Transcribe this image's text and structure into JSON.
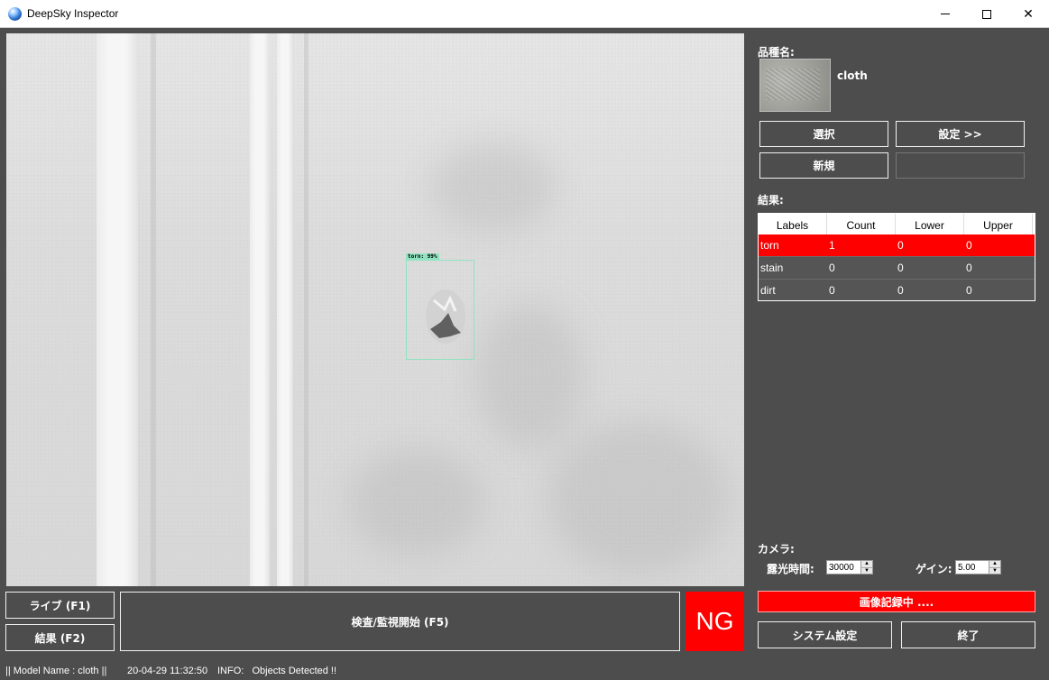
{
  "window": {
    "title": "DeepSky Inspector"
  },
  "camera_view": {
    "detection": {
      "label": "torn: 99%"
    }
  },
  "panel": {
    "model_heading": "品種名:",
    "model_name": "cloth",
    "select_button": "選択",
    "settings_button": "設定 >>",
    "new_button": "新規",
    "results_heading": "結果:"
  },
  "table": {
    "headers": [
      "Labels",
      "Count",
      "Lower",
      "Upper"
    ],
    "rows": [
      {
        "label": "torn",
        "count": "1",
        "lower": "0",
        "upper": "0",
        "selected": true
      },
      {
        "label": "stain",
        "count": "0",
        "lower": "0",
        "upper": "0",
        "selected": false
      },
      {
        "label": "dirt",
        "count": "0",
        "lower": "0",
        "upper": "0",
        "selected": false
      }
    ]
  },
  "camera": {
    "heading": "カメラ:",
    "exposure_label": "露光時間:",
    "exposure_value": "30000",
    "gain_label": "ゲイン:",
    "gain_value": "5.00"
  },
  "recording_status": "画像記録中 ....",
  "buttons": {
    "system_settings": "システム設定",
    "exit": "終了",
    "live": "ライブ (F1)",
    "results": "結果 (F2)",
    "start_inspection": "検査/監視開始 (F5)"
  },
  "judgement": {
    "text": "NG",
    "color": "#ff0000"
  },
  "status_bar": {
    "model": "|| Model Name : cloth ||",
    "timestamp": "20-04-29 11:32:50",
    "info": "INFO:   Objects Detected !!"
  },
  "colors": {
    "background": "#4d4d4d",
    "alert": "#ff0000",
    "detection_box": "#8fe3c0"
  }
}
